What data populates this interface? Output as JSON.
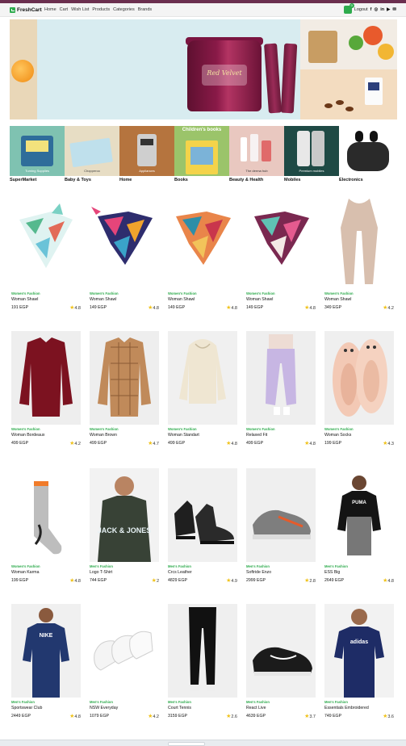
{
  "nav": {
    "brand": "FreshCart",
    "links": [
      "Home",
      "Cart",
      "Wish List",
      "Products",
      "Categories",
      "Brands"
    ],
    "cart_count": "0",
    "logout": "Logout",
    "social_icons": [
      "facebook-icon",
      "instagram-icon",
      "linkedin-icon",
      "youtube-icon",
      "mail-icon"
    ]
  },
  "hero": {
    "product_text": "Red Velvet"
  },
  "categories": [
    {
      "name": "SuperMarket",
      "caption": "Turning Supplies"
    },
    {
      "name": "Baby & Toys",
      "caption": "Chopperoo"
    },
    {
      "name": "Home",
      "caption": "Appliances"
    },
    {
      "name": "Books",
      "caption": "Children's books"
    },
    {
      "name": "Beauty & Health",
      "caption": "The derma hub"
    },
    {
      "name": "Mobiles",
      "caption": "Premium mobiles"
    },
    {
      "name": "Electronics",
      "caption": ""
    }
  ],
  "products": [
    {
      "category": "Women's Fashion",
      "title": "Woman Shawl",
      "price": "191 EGP",
      "rating": "4.8"
    },
    {
      "category": "Women's Fashion",
      "title": "Woman Shawl",
      "price": "149 EGP",
      "rating": "4.8"
    },
    {
      "category": "Women's Fashion",
      "title": "Woman Shawl",
      "price": "149 EGP",
      "rating": "4.8"
    },
    {
      "category": "Women's Fashion",
      "title": "Woman Shawl",
      "price": "149 EGP",
      "rating": "4.8"
    },
    {
      "category": "Women's Fashion",
      "title": "Woman Shawl",
      "price": "349 EGP",
      "rating": "4.2"
    },
    {
      "category": "Women's Fashion",
      "title": "Woman Bordeaux",
      "price": "499 EGP",
      "rating": "4.2"
    },
    {
      "category": "Women's Fashion",
      "title": "Woman Brown",
      "price": "499 EGP",
      "rating": "4.7"
    },
    {
      "category": "Women's Fashion",
      "title": "Woman Standart",
      "price": "499 EGP",
      "rating": "4.8"
    },
    {
      "category": "Women's Fashion",
      "title": "Relaxed Fit",
      "price": "499 EGP",
      "rating": "4.8"
    },
    {
      "category": "Women's Fashion",
      "title": "Woman Socks",
      "price": "199 EGP",
      "rating": "4.3"
    },
    {
      "category": "Women's Fashion",
      "title": "Woman Karma",
      "price": "199 EGP",
      "rating": "4.8"
    },
    {
      "category": "Men's Fashion",
      "title": "Logo T-Shirt",
      "price": "744 EGP",
      "rating": "2"
    },
    {
      "category": "Men's Fashion",
      "title": "Crcs Leather",
      "price": "4829 EGP",
      "rating": "4.9"
    },
    {
      "category": "Men's Fashion",
      "title": "Softride Enzo",
      "price": "2999 EGP",
      "rating": "2.8"
    },
    {
      "category": "Men's Fashion",
      "title": "ESS Big",
      "price": "2649 EGP",
      "rating": "4.8"
    },
    {
      "category": "Men's Fashion",
      "title": "Sportswear Club",
      "price": "2449 EGP",
      "rating": "4.8"
    },
    {
      "category": "Men's Fashion",
      "title": "NSW Everyday",
      "price": "1079 EGP",
      "rating": "4.2"
    },
    {
      "category": "Men's Fashion",
      "title": "Court Tennis",
      "price": "3159 EGP",
      "rating": "2.6"
    },
    {
      "category": "Men's Fashion",
      "title": "React Live",
      "price": "4639 EGP",
      "rating": "3.7"
    },
    {
      "category": "Men's Fashion",
      "title": "Essentials Embroidered",
      "price": "749 EGP",
      "rating": "3.6"
    }
  ],
  "product_labels": {
    "jack_jones_print": "JACK & JONES",
    "puma_print": "PUMA",
    "nike_print": "NIKE",
    "adidas_print": "adidas"
  },
  "colors": {
    "accent": "#2eab4d",
    "header_strip": "#6b2f4f",
    "star": "#f0c31c"
  }
}
